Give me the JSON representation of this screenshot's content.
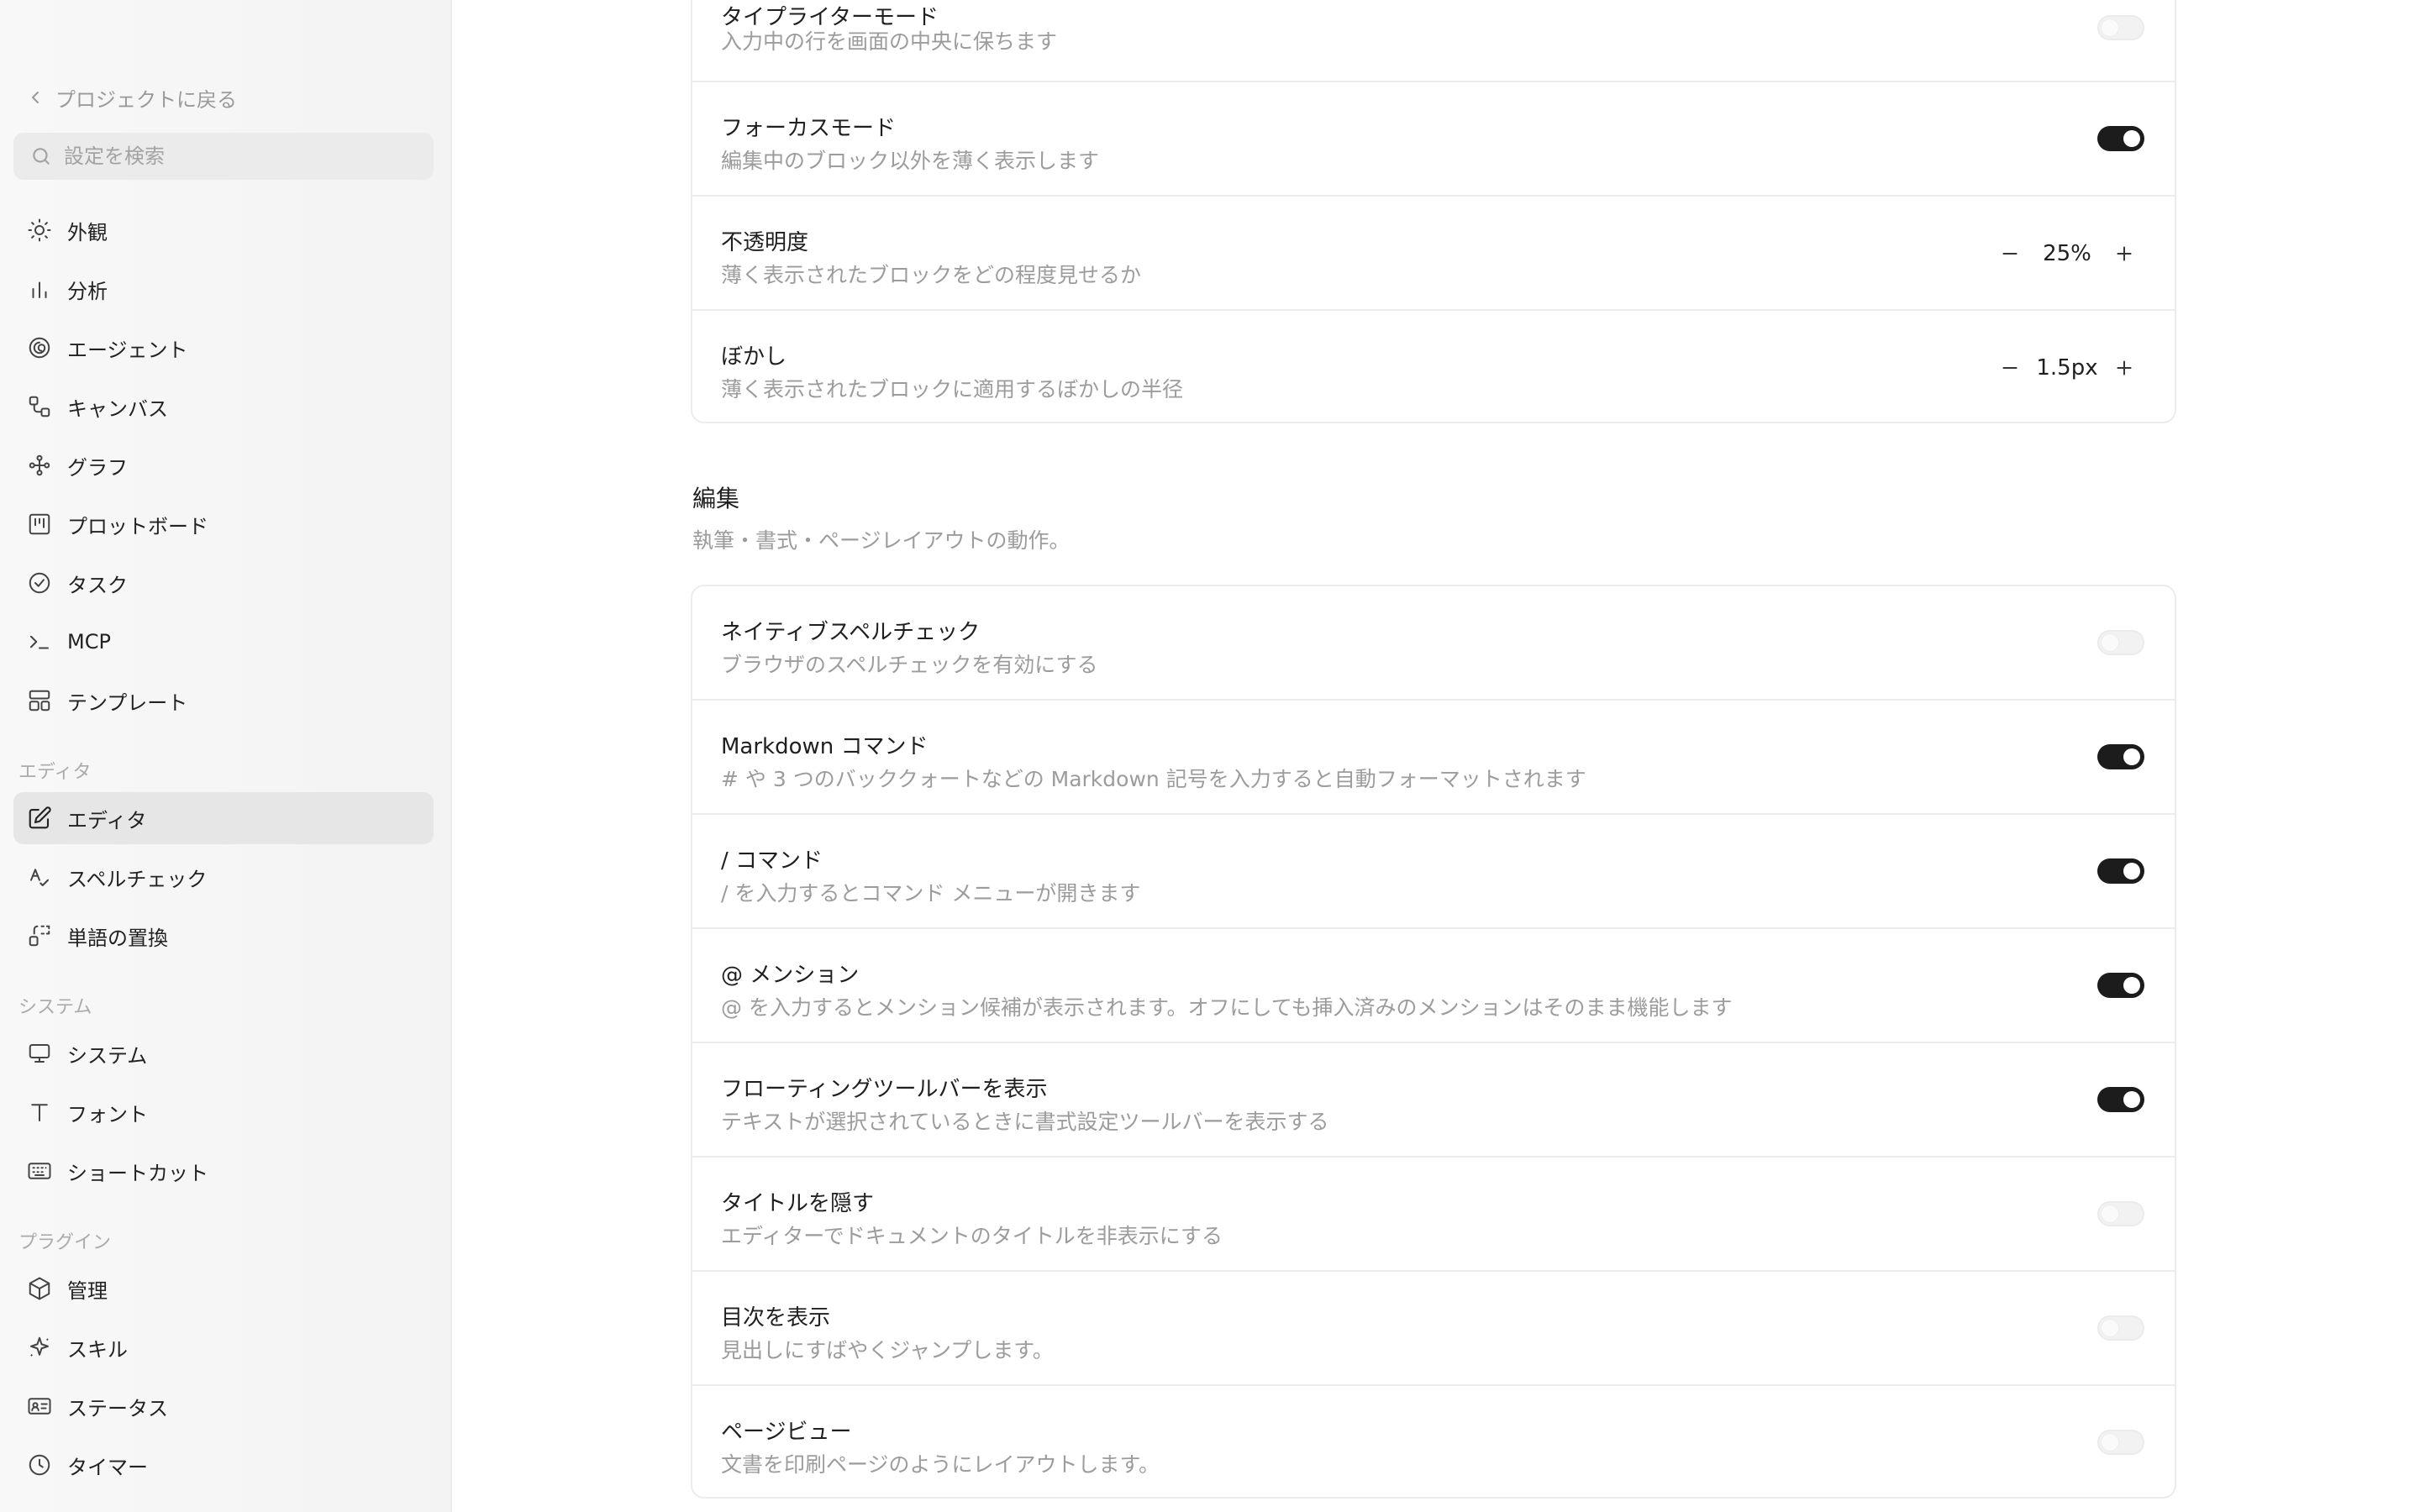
{
  "sidebar": {
    "back_label": "プロジェクトに戻る",
    "search_placeholder": "設定を検索",
    "items": [
      {
        "label": "外観",
        "icon": "sun-icon"
      },
      {
        "label": "分析",
        "icon": "bar-chart-icon"
      },
      {
        "label": "エージェント",
        "icon": "spiral-icon"
      },
      {
        "label": "キャンバス",
        "icon": "canvas-icon"
      },
      {
        "label": "グラフ",
        "icon": "graph-icon"
      },
      {
        "label": "プロットボード",
        "icon": "plotboard-icon"
      },
      {
        "label": "タスク",
        "icon": "check-circle-icon"
      },
      {
        "label": "MCP",
        "icon": "terminal-icon"
      },
      {
        "label": "テンプレート",
        "icon": "template-icon"
      }
    ],
    "editor_section": {
      "label": "エディタ",
      "items": [
        {
          "label": "エディタ",
          "icon": "edit-icon",
          "active": true
        },
        {
          "label": "スペルチェック",
          "icon": "spellcheck-icon"
        },
        {
          "label": "単語の置換",
          "icon": "replace-icon"
        }
      ]
    },
    "system_section": {
      "label": "システム",
      "items": [
        {
          "label": "システム",
          "icon": "monitor-icon"
        },
        {
          "label": "フォント",
          "icon": "font-icon"
        },
        {
          "label": "ショートカット",
          "icon": "keyboard-icon"
        }
      ]
    },
    "plugin_section": {
      "label": "プラグイン",
      "items": [
        {
          "label": "管理",
          "icon": "box-icon"
        },
        {
          "label": "スキル",
          "icon": "sparkle-icon"
        },
        {
          "label": "ステータス",
          "icon": "id-card-icon"
        },
        {
          "label": "タイマー",
          "icon": "clock-icon"
        }
      ]
    }
  },
  "focus_card": {
    "typewriter": {
      "title": "タイプライターモード",
      "desc": "入力中の行を画面の中央に保ちます",
      "enabled": false
    },
    "focus_mode": {
      "title": "フォーカスモード",
      "desc": "編集中のブロック以外を薄く表示します",
      "enabled": true
    },
    "opacity": {
      "title": "不透明度",
      "desc": "薄く表示されたブロックをどの程度見せるか",
      "value": "25%"
    },
    "blur": {
      "title": "ぼかし",
      "desc": "薄く表示されたブロックに適用するぼかしの半径",
      "value": "1.5px"
    }
  },
  "editing_section": {
    "title": "編集",
    "desc": "執筆・書式・ページレイアウトの動作。",
    "rows": [
      {
        "title": "ネイティブスペルチェック",
        "desc": "ブラウザのスペルチェックを有効にする",
        "enabled": false
      },
      {
        "title": "Markdown コマンド",
        "desc": "# や 3 つのバッククォートなどの Markdown 記号を入力すると自動フォーマットされます",
        "enabled": true
      },
      {
        "title": "/ コマンド",
        "desc": "/ を入力するとコマンド メニューが開きます",
        "enabled": true
      },
      {
        "title": "@ メンション",
        "desc": "@ を入力するとメンション候補が表示されます。オフにしても挿入済みのメンションはそのまま機能します",
        "enabled": true
      },
      {
        "title": "フローティングツールバーを表示",
        "desc": "テキストが選択されているときに書式設定ツールバーを表示する",
        "enabled": true
      },
      {
        "title": "タイトルを隠す",
        "desc": "エディターでドキュメントのタイトルを非表示にする",
        "enabled": false
      },
      {
        "title": "目次を表示",
        "desc": "見出しにすばやくジャンプします。",
        "enabled": false
      },
      {
        "title": "ページビュー",
        "desc": "文書を印刷ページのようにレイアウトします。",
        "enabled": false
      }
    ]
  },
  "colors": {
    "toggle_on": "#1c1c1c",
    "toggle_off": "#f2f2f2",
    "active_nav": "#e6e6e6"
  }
}
